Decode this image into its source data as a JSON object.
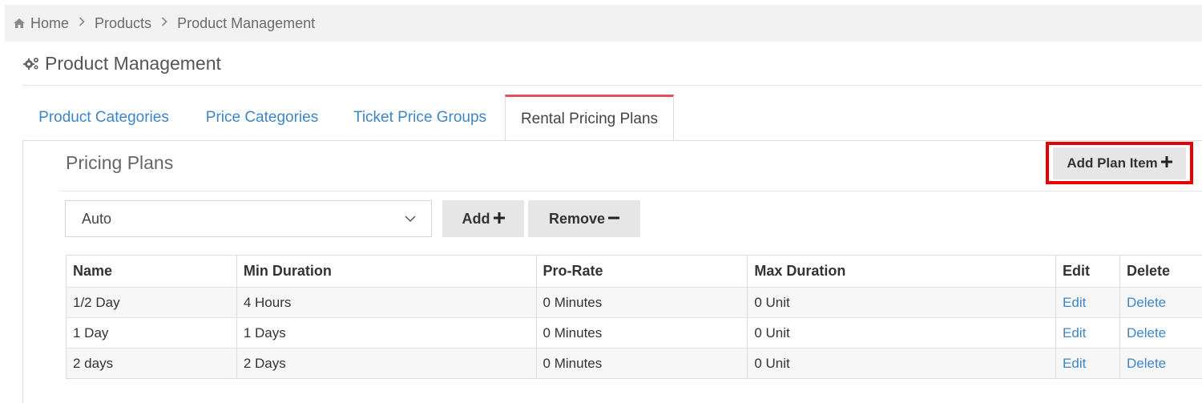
{
  "breadcrumb": {
    "items": [
      "Home",
      "Products",
      "Product Management"
    ]
  },
  "page": {
    "title": "Product Management"
  },
  "tabs": [
    {
      "label": "Product Categories",
      "active": false
    },
    {
      "label": "Price Categories",
      "active": false
    },
    {
      "label": "Ticket Price Groups",
      "active": false
    },
    {
      "label": "Rental Pricing Plans",
      "active": true
    }
  ],
  "section": {
    "title": "Pricing Plans",
    "add_plan_item_label": "Add Plan Item"
  },
  "plan_select": {
    "value": "Auto"
  },
  "buttons": {
    "add_label": "Add",
    "remove_label": "Remove"
  },
  "table": {
    "headers": [
      "Name",
      "Min Duration",
      "Pro-Rate",
      "Max Duration",
      "Edit",
      "Delete"
    ],
    "rows": [
      {
        "name": "1/2 Day",
        "min": "4 Hours",
        "prorate": "0 Minutes",
        "max": "0 Unit",
        "edit": "Edit",
        "delete": "Delete"
      },
      {
        "name": "1 Day",
        "min": "1 Days",
        "prorate": "0 Minutes",
        "max": "0 Unit",
        "edit": "Edit",
        "delete": "Delete"
      },
      {
        "name": "2 days",
        "min": "2 Days",
        "prorate": "0 Minutes",
        "max": "0 Unit",
        "edit": "Edit",
        "delete": "Delete"
      }
    ]
  },
  "colors": {
    "link": "#3d86c6",
    "active_tab_border": "#e0505a",
    "highlight": "#e60000",
    "button_bg": "#e6e6e6"
  },
  "icons": {
    "home": "home-icon",
    "separator": "chevron-right-icon",
    "title": "cogs-icon",
    "select": "chevron-down-icon",
    "plus": "plus-icon",
    "minus": "minus-icon"
  }
}
